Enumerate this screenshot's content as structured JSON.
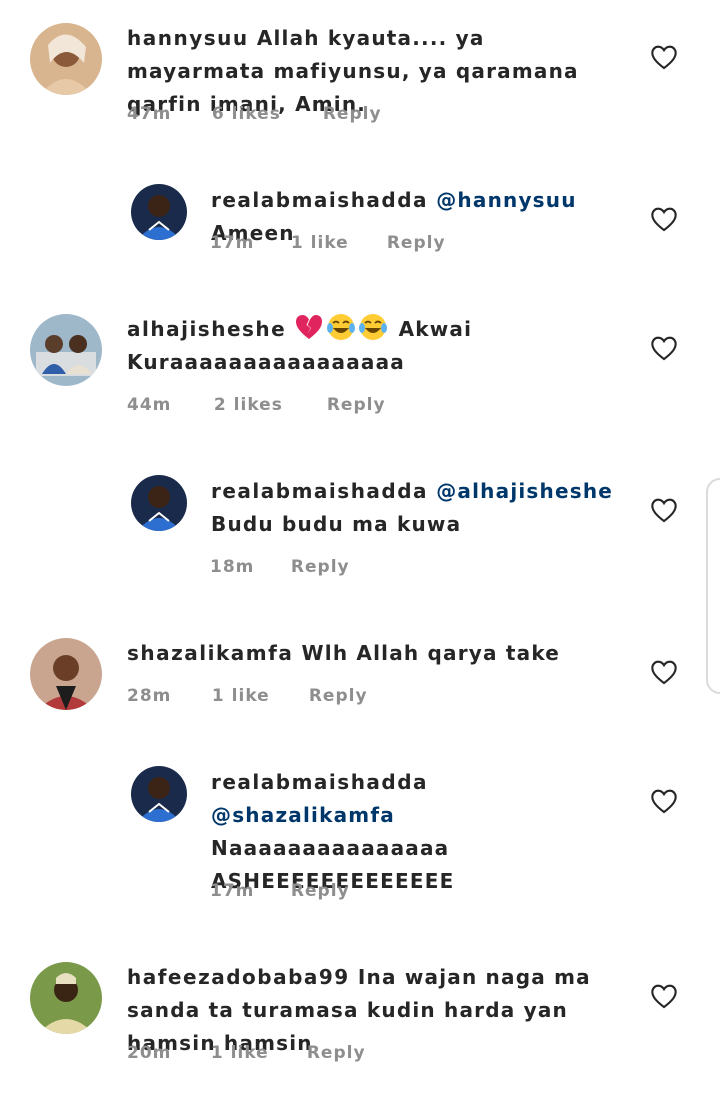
{
  "comments": [
    {
      "username": "hannysuu",
      "mention": "",
      "text": "Allah kyauta.... ya mayarmata mafiyunsu, ya qaramana qarfin imani, Amin.",
      "time": "47m",
      "likes": "6 likes",
      "reply": "Reply",
      "avatar_bg": "#c9a07a"
    },
    {
      "username": "realabmaishadda",
      "mention": "@hannysuu",
      "text": "Ameen",
      "time": "17m",
      "likes": "1 like",
      "reply": "Reply",
      "avatar_bg": "#1a3d7a"
    },
    {
      "username": "alhajisheshe",
      "mention": "",
      "text": "Akwai Kuraaaaaaaaaaaaaaaa",
      "time": "44m",
      "likes": "2 likes",
      "reply": "Reply",
      "avatar_bg": "#8aa8c0",
      "emojis": [
        "broken-heart-emoji",
        "joy-emoji",
        "joy-emoji"
      ]
    },
    {
      "username": "realabmaishadda",
      "mention": "@alhajisheshe",
      "text": "Budu budu ma kuwa",
      "time": "18m",
      "likes": "",
      "reply": "Reply",
      "avatar_bg": "#1a3d7a"
    },
    {
      "username": "shazalikamfa",
      "mention": "",
      "text": "Wlh Allah qarya take",
      "time": "28m",
      "likes": "1 like",
      "reply": "Reply",
      "avatar_bg": "#b07a60"
    },
    {
      "username": "realabmaishadda",
      "mention": "@shazalikamfa",
      "text": "Naaaaaaaaaaaaaaa ASHEEEEEEEEEEEEE",
      "time": "17m",
      "likes": "",
      "reply": "Reply",
      "avatar_bg": "#1a3d7a"
    },
    {
      "username": "hafeezadobaba99",
      "mention": "",
      "text": "Ina wajan naga ma sanda ta turamasa kudin harda yan hamsin hamsin",
      "time": "20m",
      "likes": "1 like",
      "reply": "Reply",
      "avatar_bg": "#6e8a3a"
    }
  ],
  "colors": {
    "mention": "#00376b",
    "meta": "#8e8e8e",
    "text": "#262626"
  }
}
